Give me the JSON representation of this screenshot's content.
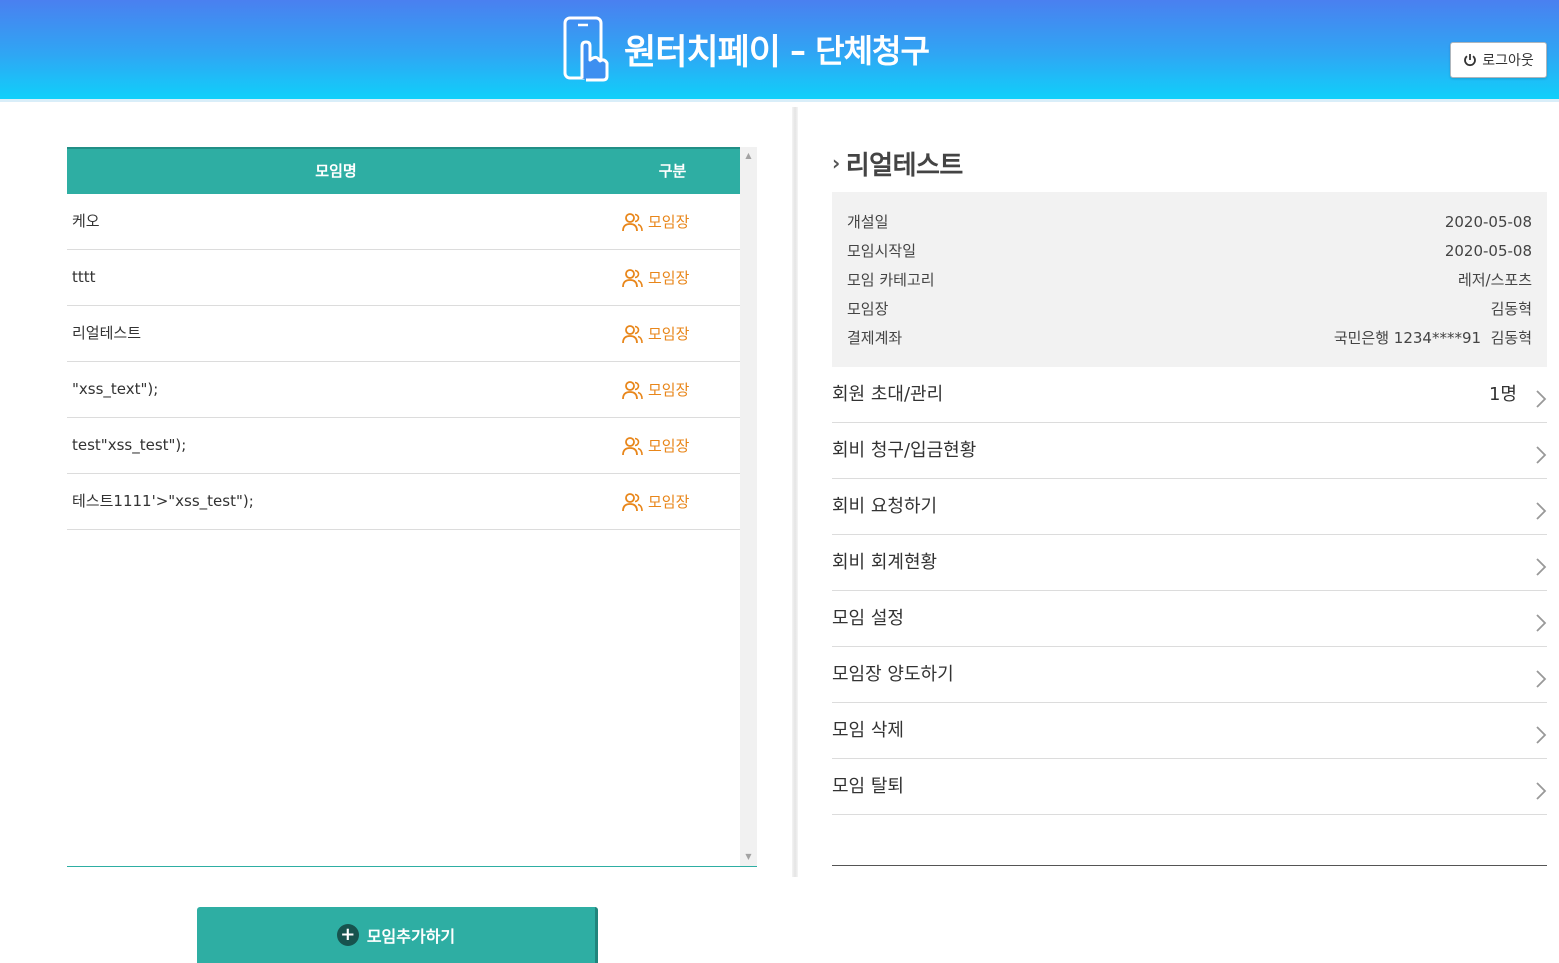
{
  "header": {
    "title": "원터치페이",
    "subtitle": "– 단체청구",
    "logout_label": "로그아웃"
  },
  "list": {
    "columns": {
      "name": "모임명",
      "type": "구분"
    },
    "rows": [
      {
        "name": "케오",
        "type": "모임장"
      },
      {
        "name": "tttt",
        "type": "모임장"
      },
      {
        "name": "리얼테스트",
        "type": "모임장"
      },
      {
        "name": "\"xss_text\");",
        "type": "모임장"
      },
      {
        "name": "test\"xss_test\");",
        "type": "모임장"
      },
      {
        "name": "테스트1111'>\"xss_test\");",
        "type": "모임장"
      }
    ],
    "add_button_label": "모임추가하기"
  },
  "detail": {
    "title": "리얼테스트",
    "info": [
      {
        "label": "개설일",
        "value": "2020-05-08"
      },
      {
        "label": "모임시작일",
        "value": "2020-05-08"
      },
      {
        "label": "모임 카테고리",
        "value": "레저/스포츠"
      },
      {
        "label": "모임장",
        "value": "김동혁"
      },
      {
        "label": "결제계좌",
        "value": "국민은행 1234****91  김동혁"
      }
    ],
    "menu": [
      {
        "label": "회원 초대/관리",
        "count": "1명"
      },
      {
        "label": "회비 청구/입금현황",
        "count": ""
      },
      {
        "label": "회비 요청하기",
        "count": ""
      },
      {
        "label": "회비 회계현황",
        "count": ""
      },
      {
        "label": "모임 설정",
        "count": ""
      },
      {
        "label": "모임장 양도하기",
        "count": ""
      },
      {
        "label": "모임 삭제",
        "count": ""
      },
      {
        "label": "모임 탈퇴",
        "count": ""
      }
    ]
  },
  "colors": {
    "accent": "#2eaea3",
    "role": "#e8861a",
    "header_top": "#4a80f0",
    "header_bottom": "#10d0fa"
  }
}
